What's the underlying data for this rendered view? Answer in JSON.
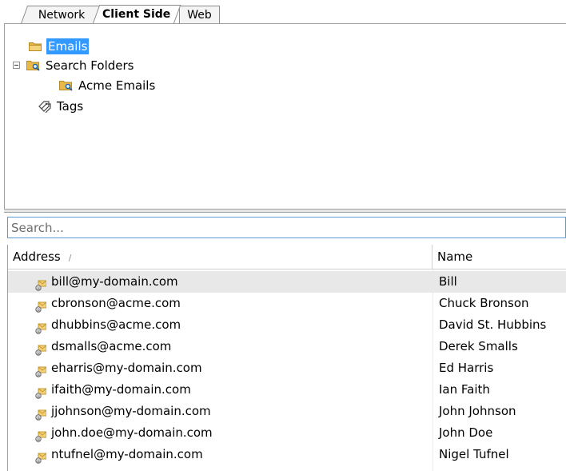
{
  "tabs": [
    {
      "label": "Network"
    },
    {
      "label": "Client Side",
      "active": true
    },
    {
      "label": "Web"
    }
  ],
  "tree": {
    "items": [
      {
        "label": "Emails",
        "icon": "folder-icon",
        "selected": true
      },
      {
        "label": "Search Folders",
        "icon": "search-folder-icon",
        "expanded": true
      },
      {
        "label": "Acme Emails",
        "icon": "search-folder-icon"
      },
      {
        "label": "Tags",
        "icon": "tag-icon"
      }
    ]
  },
  "search": {
    "placeholder": "Search...",
    "value": ""
  },
  "grid": {
    "columns": {
      "address": "Address",
      "name": "Name"
    },
    "sort_indicator": "/",
    "rows": [
      {
        "address": "bill@my-domain.com",
        "name": "Bill"
      },
      {
        "address": "cbronson@acme.com",
        "name": "Chuck Bronson"
      },
      {
        "address": "dhubbins@acme.com",
        "name": "David St. Hubbins"
      },
      {
        "address": "dsmalls@acme.com",
        "name": "Derek Smalls"
      },
      {
        "address": "eharris@my-domain.com",
        "name": "Ed Harris"
      },
      {
        "address": "ifaith@my-domain.com",
        "name": "Ian Faith"
      },
      {
        "address": "jjohnson@my-domain.com",
        "name": "John Johnson"
      },
      {
        "address": "john.doe@my-domain.com",
        "name": "John Doe"
      },
      {
        "address": "ntufnel@my-domain.com",
        "name": "Nigel Tufnel"
      }
    ]
  },
  "colors": {
    "selection": "#3399ff",
    "row_highlight": "#e8e8e8",
    "search_border": "#5b9bd5"
  }
}
